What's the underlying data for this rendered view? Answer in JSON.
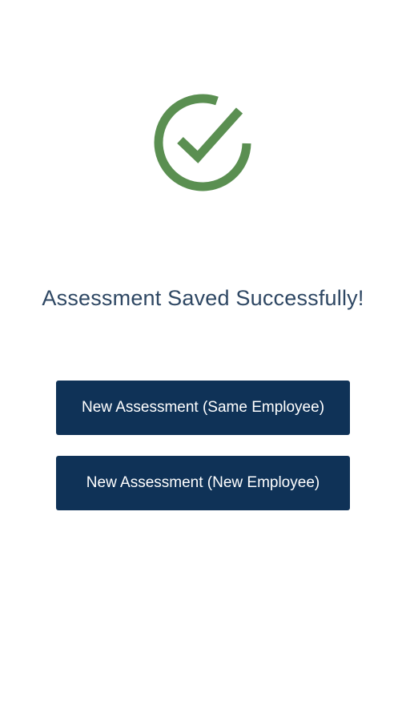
{
  "colors": {
    "success_green": "#5a8f51",
    "button_navy": "#0f3257",
    "message_text": "#2e4763",
    "background": "#ffffff"
  },
  "success": {
    "icon": "check-circle-icon",
    "message": "Assessment Saved Successfully!"
  },
  "actions": {
    "same_employee_label": "New Assessment (Same Employee)",
    "new_employee_label": "New Assessment (New Employee)"
  }
}
